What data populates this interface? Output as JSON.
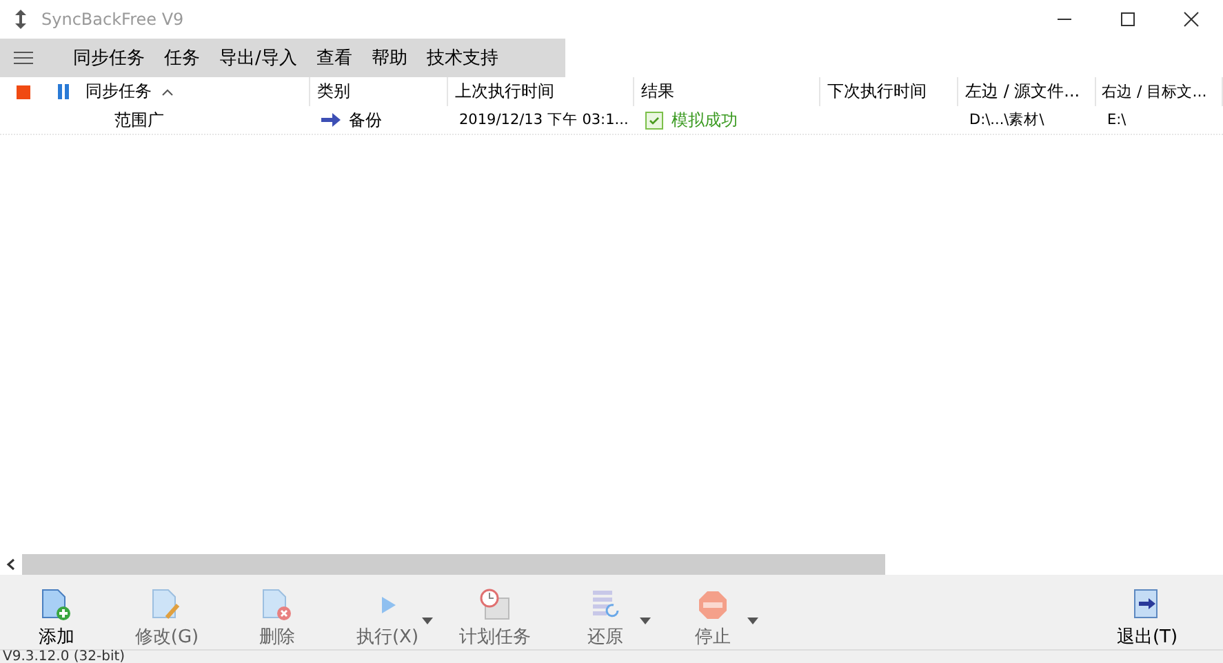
{
  "window": {
    "title": "SyncBackFree V9"
  },
  "menu": [
    "同步任务",
    "任务",
    "导出/导入",
    "查看",
    "帮助",
    "技术支持"
  ],
  "table": {
    "columns": [
      {
        "label": "同步任务",
        "sorted": true
      },
      {
        "label": "类别",
        "sorted": false
      },
      {
        "label": "上次执行时间",
        "sorted": false
      },
      {
        "label": "结果",
        "sorted": false
      },
      {
        "label": "下次执行时间",
        "sorted": false
      },
      {
        "label": "左边 / 源文件...",
        "sorted": false
      },
      {
        "label": "右边 / 目标文...",
        "sorted": false
      }
    ],
    "rows": [
      {
        "name": "范围广",
        "type": "备份",
        "last_run": "2019/12/13 下午 03:1...",
        "result": "模拟成功",
        "next_run": "",
        "left": "D:\\...\\素材\\",
        "right": "E:\\"
      }
    ]
  },
  "toolbar": [
    {
      "kind": "add",
      "label": "添加",
      "disabled": false,
      "dropdown": false
    },
    {
      "kind": "edit",
      "label": "修改(G)",
      "disabled": true,
      "dropdown": false
    },
    {
      "kind": "delete",
      "label": "删除",
      "disabled": true,
      "dropdown": false
    },
    {
      "kind": "run",
      "label": "执行(X)",
      "disabled": true,
      "dropdown": true
    },
    {
      "kind": "schedule",
      "label": "计划任务",
      "disabled": true,
      "dropdown": false
    },
    {
      "kind": "restore",
      "label": "还原",
      "disabled": true,
      "dropdown": true
    },
    {
      "kind": "stop",
      "label": "停止",
      "disabled": true,
      "dropdown": true
    },
    {
      "kind": "spacer"
    },
    {
      "kind": "exit",
      "label": "退出(T)",
      "disabled": false,
      "dropdown": false
    }
  ],
  "status_bar": [
    "V9.3.12.0 (32-bit)"
  ]
}
